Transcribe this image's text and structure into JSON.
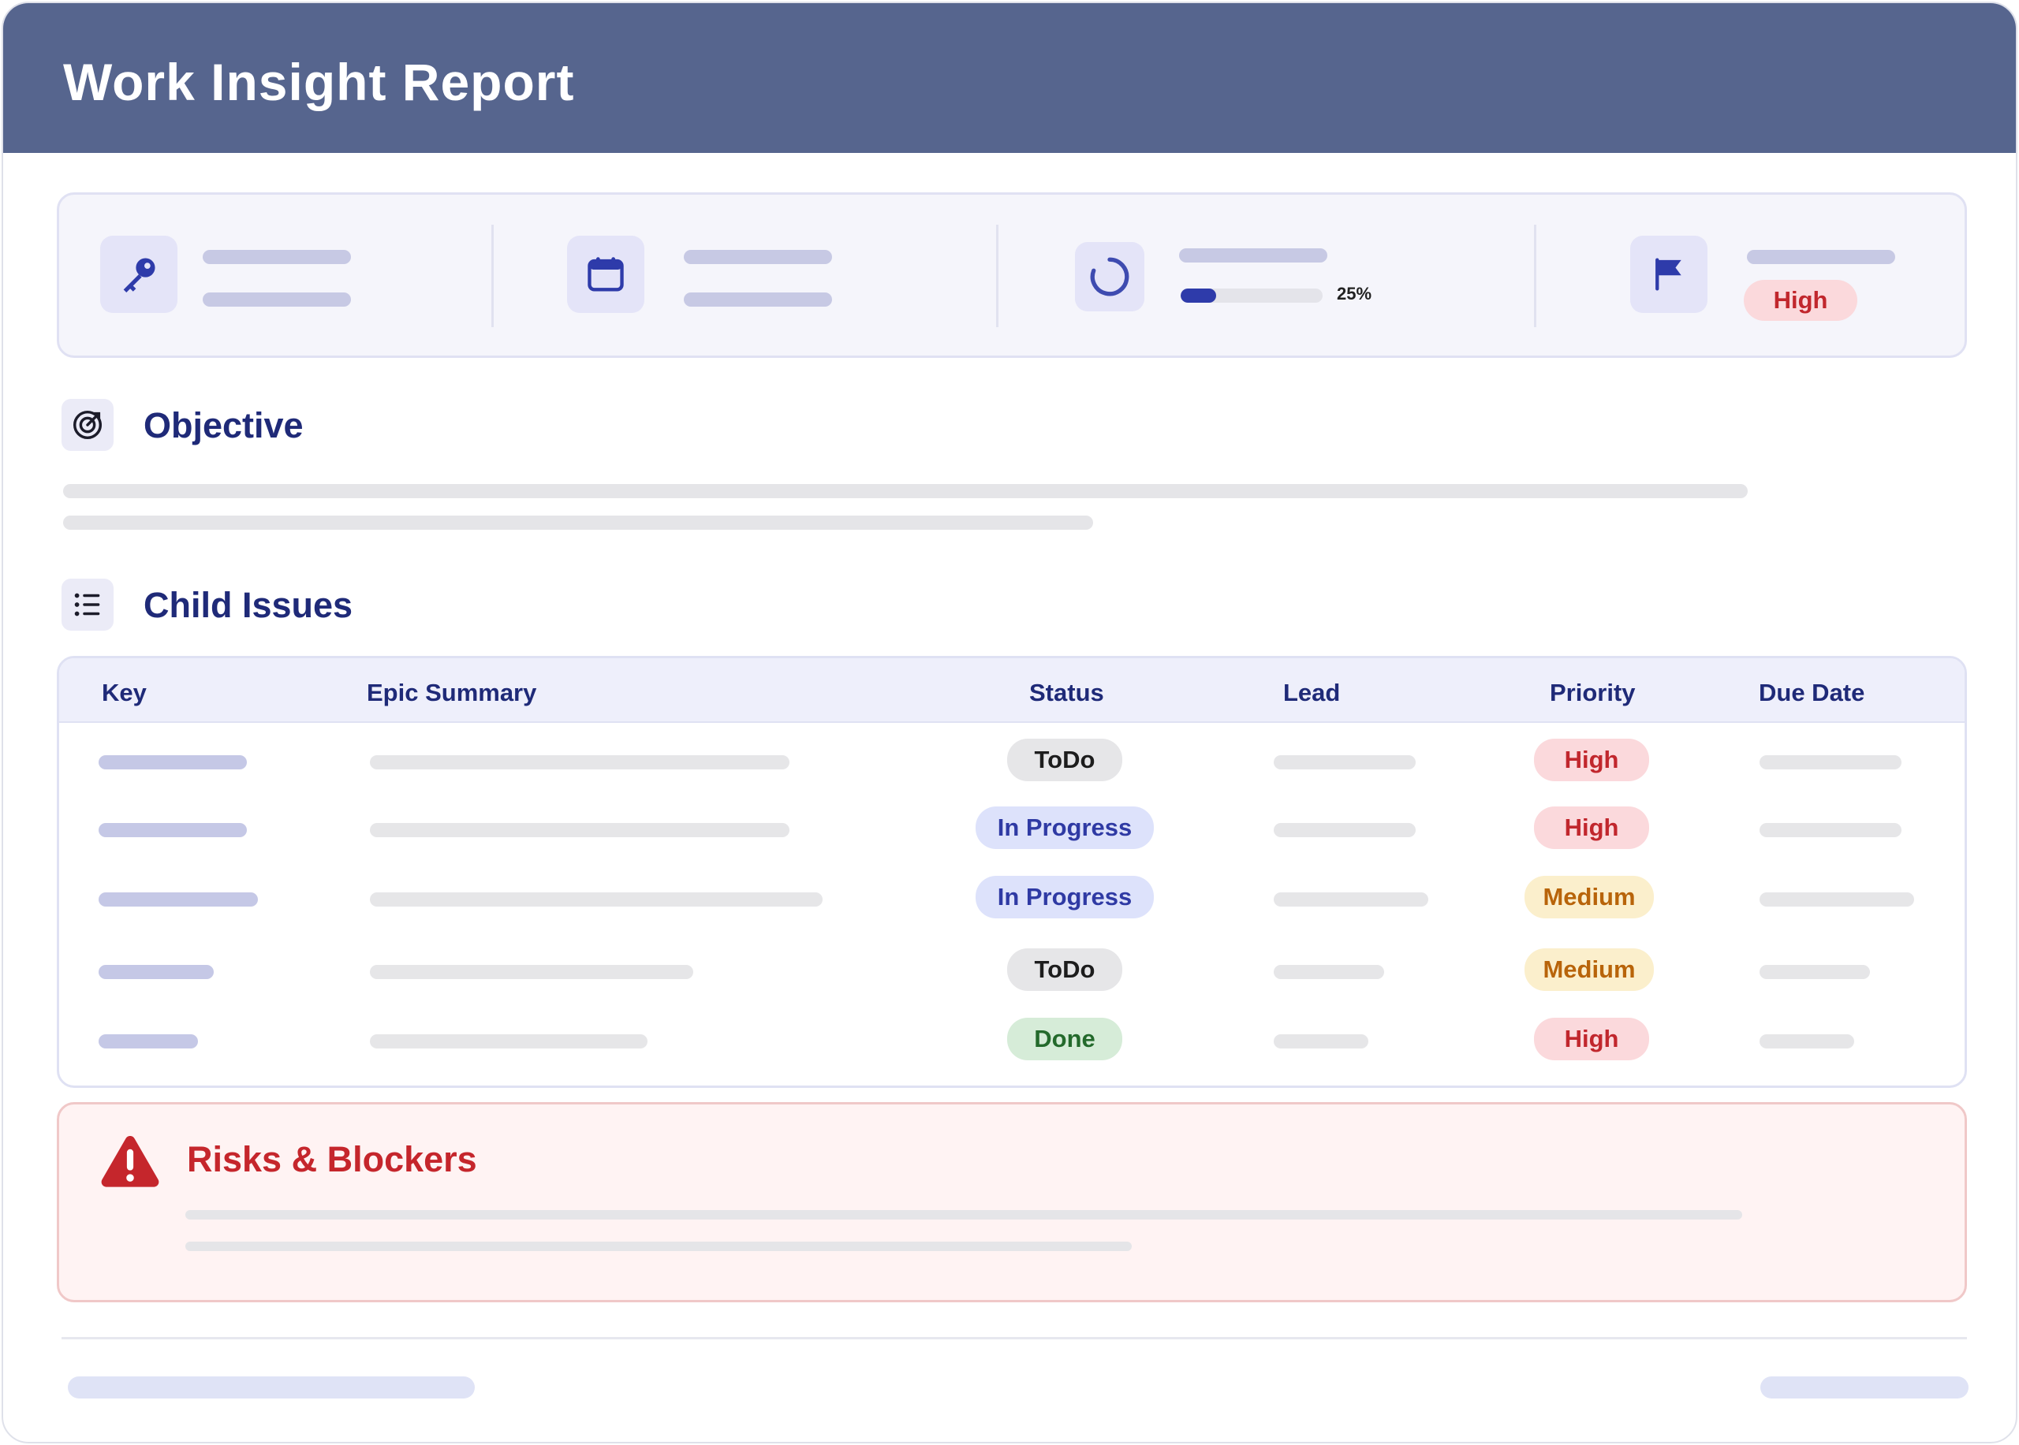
{
  "report": {
    "title": "Work Insight Report"
  },
  "summary": {
    "items": [
      {
        "icon": "key-icon"
      },
      {
        "icon": "calendar-icon"
      },
      {
        "icon": "progress-spinner-icon",
        "progress_percent": 25,
        "progress_label": "25%"
      },
      {
        "icon": "flag-icon",
        "priority": "High"
      }
    ]
  },
  "objective": {
    "title": "Objective",
    "icon": "target-icon"
  },
  "child_issues": {
    "title": "Child Issues",
    "icon": "list-icon",
    "columns": [
      "Key",
      "Epic Summary",
      "Status",
      "Lead",
      "Priority",
      "Due Date"
    ],
    "rows": [
      {
        "status": "ToDo",
        "status_type": "todo",
        "priority": "High",
        "priority_type": "high"
      },
      {
        "status": "In Progress",
        "status_type": "progress",
        "priority": "High",
        "priority_type": "high"
      },
      {
        "status": "In Progress",
        "status_type": "progress",
        "priority": "Medium",
        "priority_type": "medium"
      },
      {
        "status": "ToDo",
        "status_type": "todo",
        "priority": "Medium",
        "priority_type": "medium"
      },
      {
        "status": "Done",
        "status_type": "done",
        "priority": "High",
        "priority_type": "high"
      }
    ]
  },
  "risks": {
    "title": "Risks & Blockers",
    "icon": "warning-icon"
  },
  "colors": {
    "header": "#56658e",
    "accent": "#1f2a78",
    "progress": "#2e3baa",
    "danger": "#c5262c"
  }
}
